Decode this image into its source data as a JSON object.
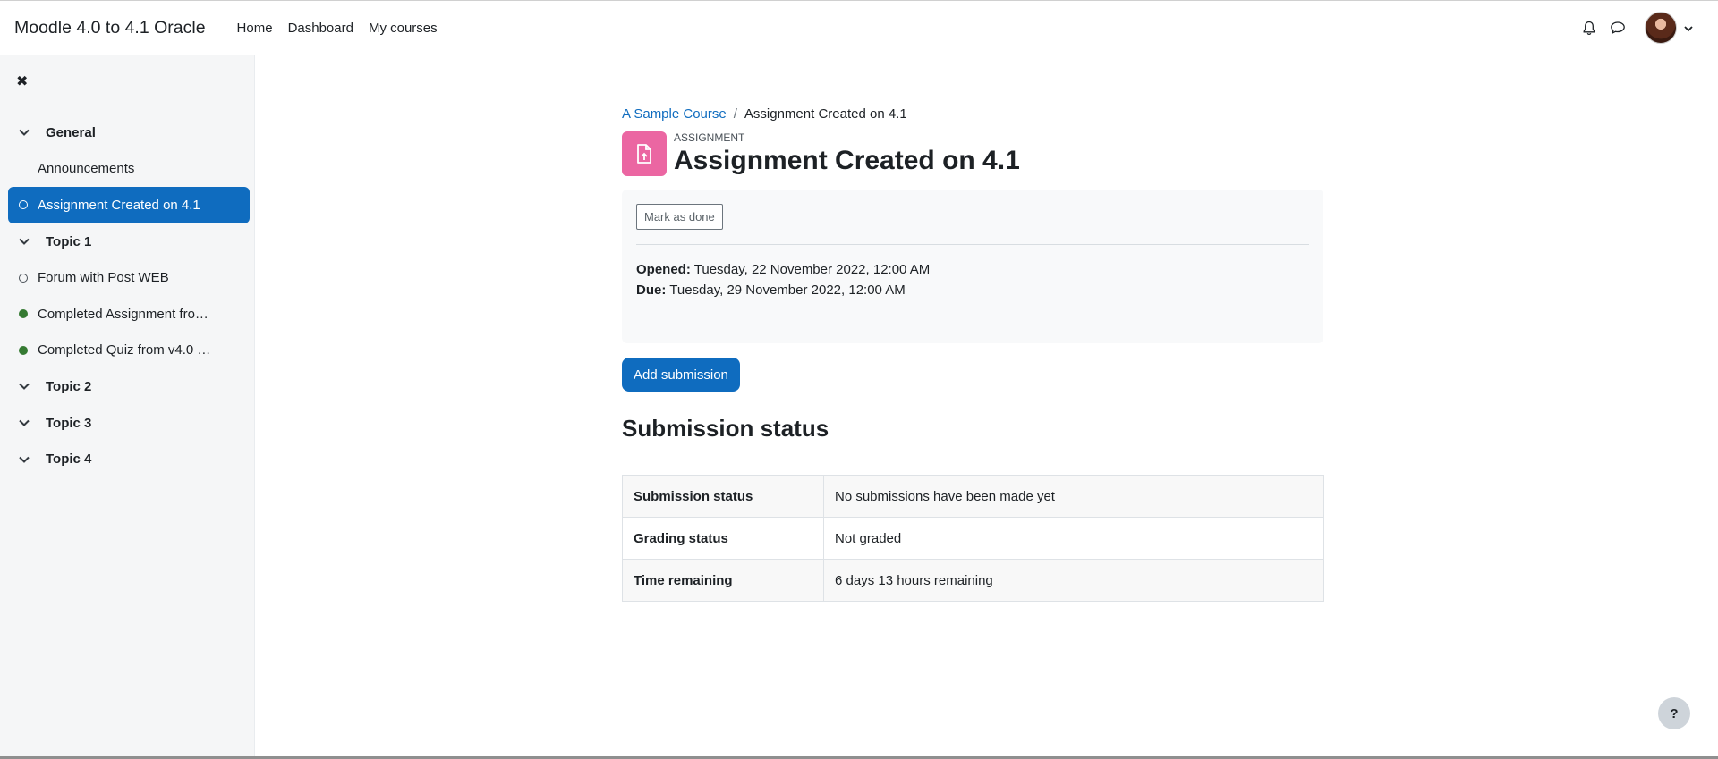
{
  "app": {
    "site_name": "Moodle 4.0 to 4.1 Oracle",
    "nav": [
      "Home",
      "Dashboard",
      "My courses"
    ],
    "icons": {
      "notifications": "bell-icon",
      "messages": "speech-bubble-icon",
      "user_menu": "chevron-down-icon"
    }
  },
  "drawer": {
    "close_icon": "close-icon",
    "sections": [
      {
        "label": "General",
        "items": [
          {
            "label": "Announcements",
            "mark": "none"
          },
          {
            "label": "Assignment Created on 4.1",
            "mark": "empty",
            "active": true
          }
        ]
      },
      {
        "label": "Topic 1",
        "items": [
          {
            "label": "Forum with Post WEB",
            "mark": "empty"
          },
          {
            "label": "Completed Assignment fro…",
            "mark": "done"
          },
          {
            "label": "Completed Quiz from v4.0 …",
            "mark": "done"
          }
        ]
      },
      {
        "label": "Topic 2",
        "items": []
      },
      {
        "label": "Topic 3",
        "items": []
      },
      {
        "label": "Topic 4",
        "items": []
      }
    ]
  },
  "breadcrumb": {
    "course": "A Sample Course",
    "separator": "/",
    "current": "Assignment Created on 4.1"
  },
  "activity": {
    "type": "ASSIGNMENT",
    "title": "Assignment Created on 4.1",
    "icon": "assignment-upload-icon",
    "icon_color": "#eb66a2"
  },
  "dates_box": {
    "mark_done_label": "Mark as done",
    "opened_label": "Opened:",
    "opened_value": "Tuesday, 22 November 2022, 12:00 AM",
    "due_label": "Due:",
    "due_value": "Tuesday, 29 November 2022, 12:00 AM"
  },
  "add_submission_label": "Add submission",
  "submission": {
    "heading": "Submission status",
    "rows": [
      {
        "key": "Submission status",
        "value": "No submissions have been made yet"
      },
      {
        "key": "Grading status",
        "value": "Not graded"
      },
      {
        "key": "Time remaining",
        "value": "6 days 13 hours remaining"
      }
    ]
  },
  "help_button": "?",
  "colors": {
    "primary": "#0f6cbf",
    "done": "#357a32",
    "drawer_bg": "#f5f6f7"
  }
}
